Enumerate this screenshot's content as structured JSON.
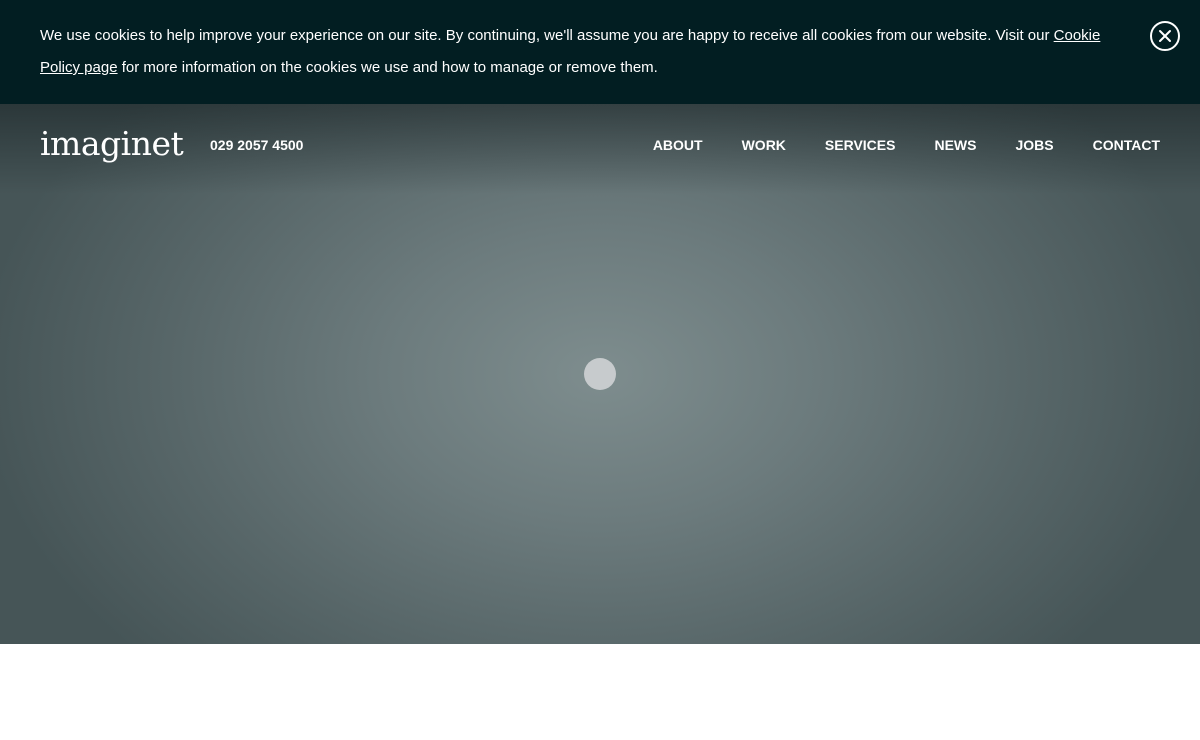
{
  "cookie_banner": {
    "text_before_link": "We use cookies to help improve your experience on our site. By continuing, we'll assume you are happy to receive all cookies from our website. Visit our ",
    "link_text": "Cookie Policy page",
    "text_after_link": " for more information on the cookies we use and how to manage or remove them.",
    "close_icon": "close-icon"
  },
  "header": {
    "logo": "imaginet",
    "phone": "029 2057 4500",
    "nav": [
      {
        "label": "ABOUT"
      },
      {
        "label": "WORK"
      },
      {
        "label": "SERVICES"
      },
      {
        "label": "NEWS"
      },
      {
        "label": "JOBS"
      },
      {
        "label": "CONTACT"
      }
    ]
  },
  "colors": {
    "banner_bg": "#021e22",
    "hero_center": "#7e8d8e",
    "hero_edge": "#465557",
    "loader": "#c7cbcd"
  }
}
